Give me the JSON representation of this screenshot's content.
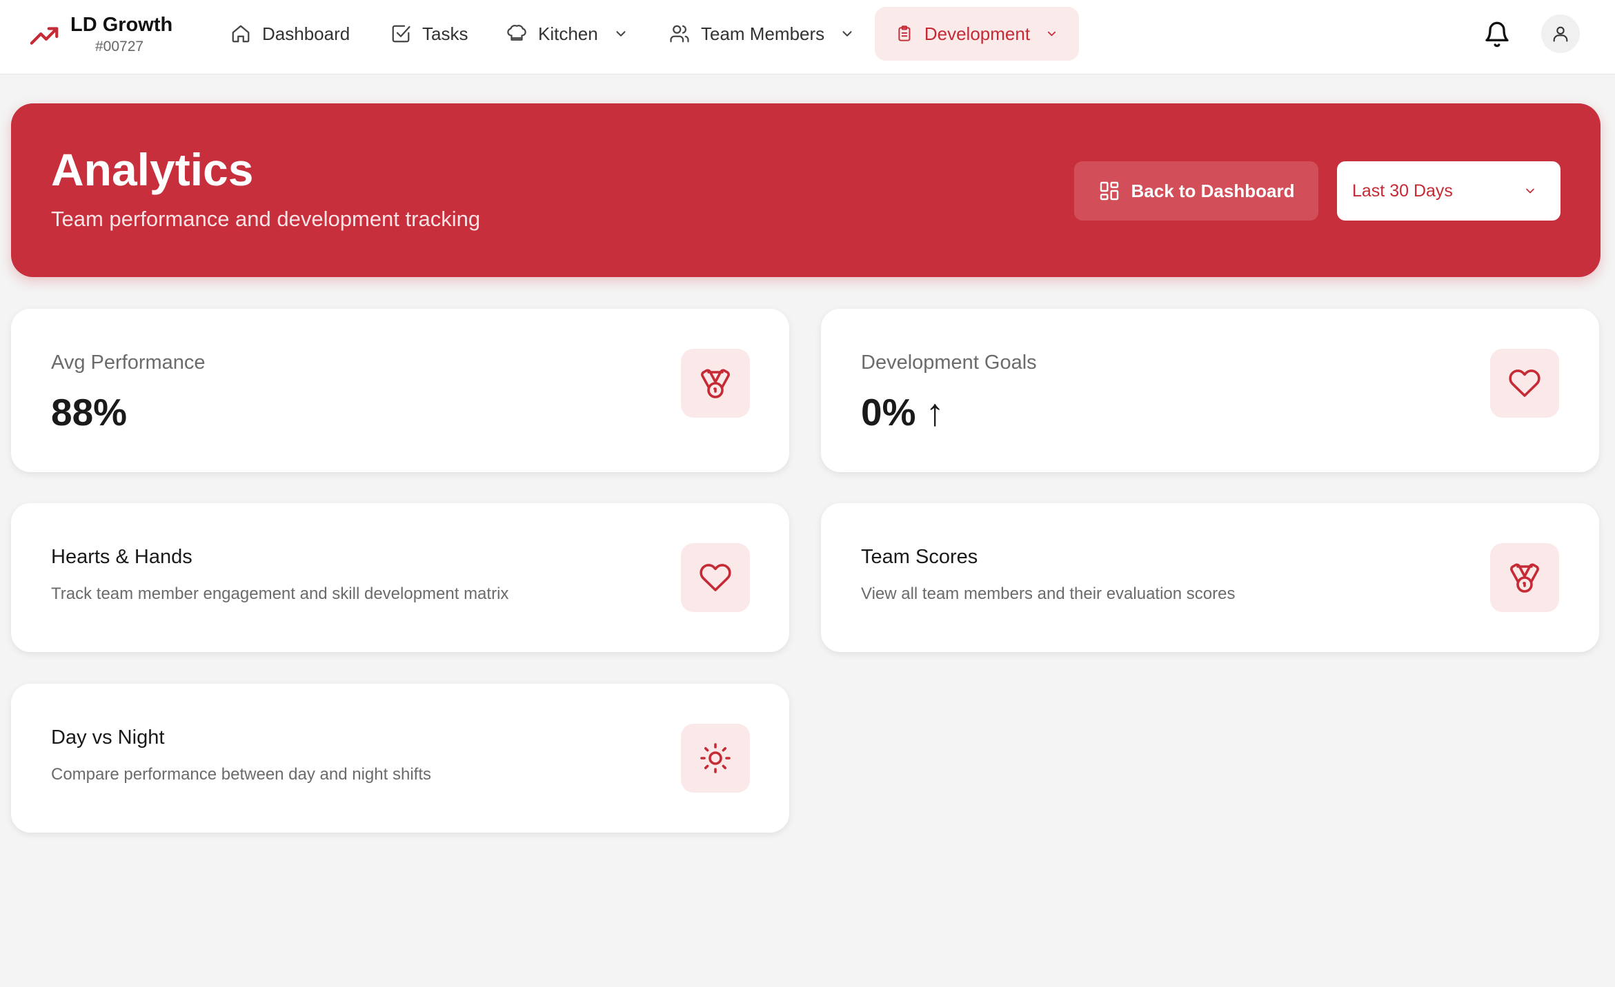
{
  "brand": {
    "name": "LD Growth",
    "code": "#00727",
    "icon": "trending-up-icon"
  },
  "nav": {
    "items": [
      {
        "label": "Dashboard",
        "icon": "home-icon"
      },
      {
        "label": "Tasks",
        "icon": "check-square-icon"
      },
      {
        "label": "Kitchen",
        "icon": "chef-hat-icon",
        "dropdown": true
      },
      {
        "label": "Team Members",
        "icon": "users-icon",
        "dropdown": true
      },
      {
        "label": "Development",
        "icon": "clipboard-icon",
        "dropdown": true,
        "active": true
      }
    ]
  },
  "header_actions": {
    "notifications_icon": "bell-icon",
    "profile_icon": "user-icon"
  },
  "hero": {
    "title": "Analytics",
    "subtitle": "Team performance and development tracking",
    "back_button": "Back to Dashboard",
    "range_select": {
      "value": "Last 30 Days"
    }
  },
  "stats": [
    {
      "label": "Avg Performance",
      "value": "88%",
      "icon": "medal-icon"
    },
    {
      "label": "Development Goals",
      "value": "0%",
      "trend": "↑",
      "icon": "heart-icon"
    }
  ],
  "links": [
    {
      "title": "Hearts & Hands",
      "description": "Track team member engagement and skill development matrix",
      "icon": "heart-icon"
    },
    {
      "title": "Team Scores",
      "description": "View all team members and their evaluation scores",
      "icon": "medal-icon"
    },
    {
      "title": "Day vs Night",
      "description": "Compare performance between day and night shifts",
      "icon": "sun-icon"
    }
  ],
  "colors": {
    "accent": "#c62f3b",
    "accent_soft": "#fbe9e9",
    "background": "#f4f4f4"
  }
}
